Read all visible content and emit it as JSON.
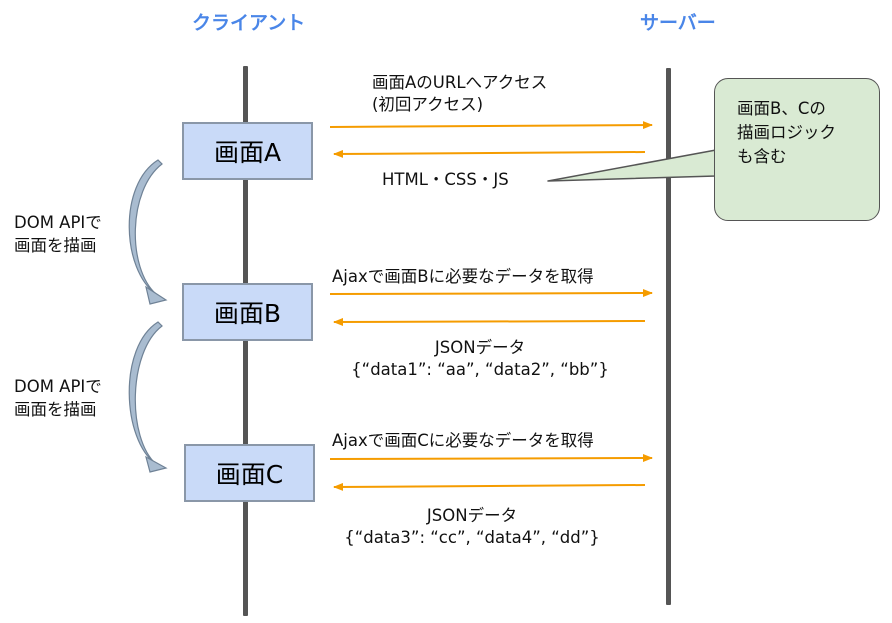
{
  "lanes": {
    "client": "クライアント",
    "server": "サーバー"
  },
  "screens": [
    {
      "label": "画面A"
    },
    {
      "label": "画面B"
    },
    {
      "label": "画面C"
    }
  ],
  "messages": {
    "access_a_line1": "画面AのURLへアクセス",
    "access_a_line2": "(初回アクセス)",
    "response_a": "HTML・CSS・JS",
    "ajax_b": "Ajaxで画面Bに必要なデータを取得",
    "response_b_line1": "JSONデータ",
    "response_b_line2": "{“data1”: “aa”, “data2”, “bb”}",
    "ajax_c": "Ajaxで画面Cに必要なデータを取得",
    "response_c_line1": "JSONデータ",
    "response_c_line2": "{“data3”: “cc”, “data4”, “dd”}"
  },
  "transitions": [
    {
      "line1": "DOM APIで",
      "line2": "画面を描画"
    },
    {
      "line1": "DOM APIで",
      "line2": "画面を描画"
    }
  ],
  "callout": {
    "line1": "画面B、Cの",
    "line2": "描画ロジック",
    "line3": "も含む"
  },
  "colors": {
    "lane_title": "#4a86e8",
    "screen_fill": "#c9daf8",
    "arrow": "#f59c00",
    "callout_fill": "#d9ead3",
    "curved_arrow": "#9fb3c8"
  }
}
